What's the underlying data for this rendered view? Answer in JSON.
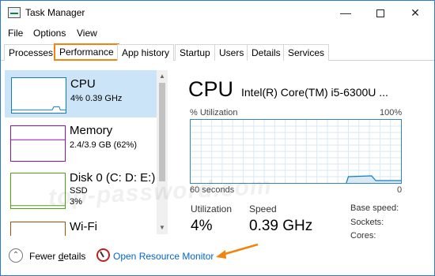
{
  "window": {
    "title": "Task Manager",
    "controls": {
      "minimize": "—",
      "close": "✕"
    }
  },
  "menu": [
    "File",
    "Options",
    "View"
  ],
  "tabs": [
    {
      "label": "Processes",
      "active": false
    },
    {
      "label": "Performance",
      "active": true
    },
    {
      "label": "App history",
      "active": false
    },
    {
      "label": "Startup",
      "active": false
    },
    {
      "label": "Users",
      "active": false
    },
    {
      "label": "Details",
      "active": false
    },
    {
      "label": "Services",
      "active": false
    }
  ],
  "sidebar": {
    "items": [
      {
        "name": "CPU",
        "detail": "4%  0.39 GHz",
        "detail2": "",
        "selected": true,
        "color": "#117dbb",
        "level": 0.04
      },
      {
        "name": "Memory",
        "detail": "2.4/3.9 GB (62%)",
        "detail2": "",
        "selected": false,
        "color": "#8b12ae",
        "level": 0.62
      },
      {
        "name": "Disk 0 (C: D: E:)",
        "detail": "SSD",
        "detail2": "3%",
        "selected": false,
        "color": "#4da60c",
        "level": 0.03
      },
      {
        "name": "Wi-Fi",
        "detail": "",
        "detail2": "",
        "selected": false,
        "color": "#a74f01",
        "level": 0.0
      }
    ]
  },
  "main": {
    "title": "CPU",
    "model": "Intel(R) Core(TM) i5-6300U ...",
    "graph": {
      "y_label": "% Utilization",
      "y_max_label": "100%",
      "x_left_label": "60 seconds",
      "x_right_label": "0",
      "line_color": "#117dbb",
      "fill_color": "#d9eaf7",
      "grid_color": "#d9eaf7"
    },
    "stats": [
      {
        "label": "Utilization",
        "value": "4%"
      },
      {
        "label": "Speed",
        "value": "0.39 GHz"
      }
    ],
    "details": [
      "Base speed:",
      "Sockets:",
      "Cores:"
    ]
  },
  "footer": {
    "fewer_details_prefix": "Fewer ",
    "fewer_details_underlined": "d",
    "fewer_details_suffix": "etails",
    "resource_monitor": "Open Resource Monitor"
  },
  "annotation": {
    "arrow_color": "#f0840c"
  },
  "watermark": "top-password.com"
}
